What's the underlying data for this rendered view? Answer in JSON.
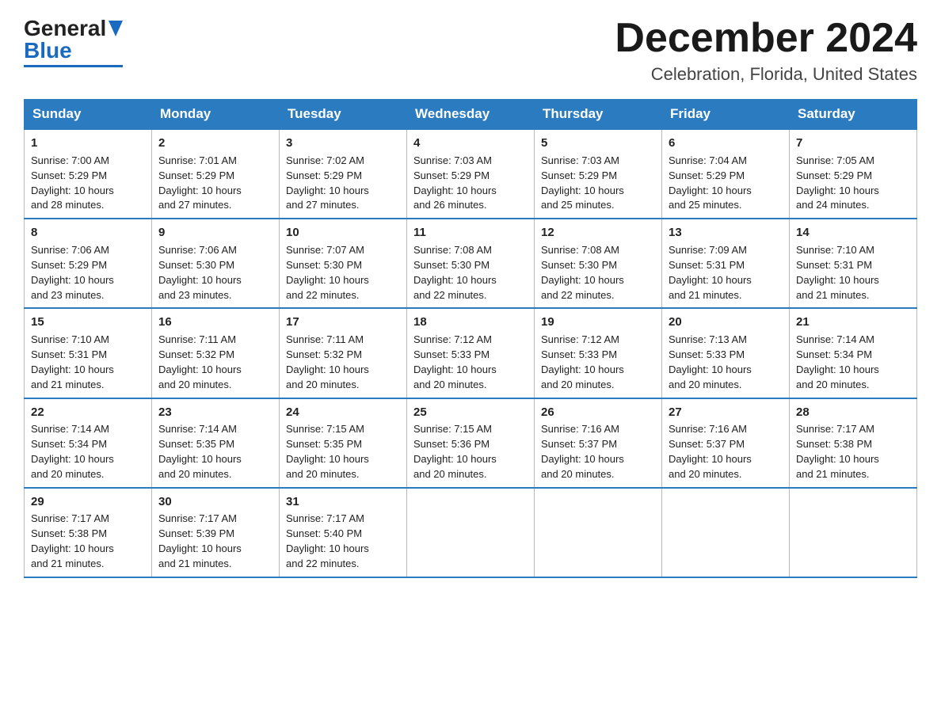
{
  "header": {
    "logo_line1": "General",
    "logo_line2": "Blue",
    "month_title": "December 2024",
    "subtitle": "Celebration, Florida, United States"
  },
  "weekdays": [
    "Sunday",
    "Monday",
    "Tuesday",
    "Wednesday",
    "Thursday",
    "Friday",
    "Saturday"
  ],
  "weeks": [
    [
      {
        "day": "1",
        "sunrise": "Sunrise: 7:00 AM",
        "sunset": "Sunset: 5:29 PM",
        "daylight": "Daylight: 10 hours",
        "daylight2": "and 28 minutes."
      },
      {
        "day": "2",
        "sunrise": "Sunrise: 7:01 AM",
        "sunset": "Sunset: 5:29 PM",
        "daylight": "Daylight: 10 hours",
        "daylight2": "and 27 minutes."
      },
      {
        "day": "3",
        "sunrise": "Sunrise: 7:02 AM",
        "sunset": "Sunset: 5:29 PM",
        "daylight": "Daylight: 10 hours",
        "daylight2": "and 27 minutes."
      },
      {
        "day": "4",
        "sunrise": "Sunrise: 7:03 AM",
        "sunset": "Sunset: 5:29 PM",
        "daylight": "Daylight: 10 hours",
        "daylight2": "and 26 minutes."
      },
      {
        "day": "5",
        "sunrise": "Sunrise: 7:03 AM",
        "sunset": "Sunset: 5:29 PM",
        "daylight": "Daylight: 10 hours",
        "daylight2": "and 25 minutes."
      },
      {
        "day": "6",
        "sunrise": "Sunrise: 7:04 AM",
        "sunset": "Sunset: 5:29 PM",
        "daylight": "Daylight: 10 hours",
        "daylight2": "and 25 minutes."
      },
      {
        "day": "7",
        "sunrise": "Sunrise: 7:05 AM",
        "sunset": "Sunset: 5:29 PM",
        "daylight": "Daylight: 10 hours",
        "daylight2": "and 24 minutes."
      }
    ],
    [
      {
        "day": "8",
        "sunrise": "Sunrise: 7:06 AM",
        "sunset": "Sunset: 5:29 PM",
        "daylight": "Daylight: 10 hours",
        "daylight2": "and 23 minutes."
      },
      {
        "day": "9",
        "sunrise": "Sunrise: 7:06 AM",
        "sunset": "Sunset: 5:30 PM",
        "daylight": "Daylight: 10 hours",
        "daylight2": "and 23 minutes."
      },
      {
        "day": "10",
        "sunrise": "Sunrise: 7:07 AM",
        "sunset": "Sunset: 5:30 PM",
        "daylight": "Daylight: 10 hours",
        "daylight2": "and 22 minutes."
      },
      {
        "day": "11",
        "sunrise": "Sunrise: 7:08 AM",
        "sunset": "Sunset: 5:30 PM",
        "daylight": "Daylight: 10 hours",
        "daylight2": "and 22 minutes."
      },
      {
        "day": "12",
        "sunrise": "Sunrise: 7:08 AM",
        "sunset": "Sunset: 5:30 PM",
        "daylight": "Daylight: 10 hours",
        "daylight2": "and 22 minutes."
      },
      {
        "day": "13",
        "sunrise": "Sunrise: 7:09 AM",
        "sunset": "Sunset: 5:31 PM",
        "daylight": "Daylight: 10 hours",
        "daylight2": "and 21 minutes."
      },
      {
        "day": "14",
        "sunrise": "Sunrise: 7:10 AM",
        "sunset": "Sunset: 5:31 PM",
        "daylight": "Daylight: 10 hours",
        "daylight2": "and 21 minutes."
      }
    ],
    [
      {
        "day": "15",
        "sunrise": "Sunrise: 7:10 AM",
        "sunset": "Sunset: 5:31 PM",
        "daylight": "Daylight: 10 hours",
        "daylight2": "and 21 minutes."
      },
      {
        "day": "16",
        "sunrise": "Sunrise: 7:11 AM",
        "sunset": "Sunset: 5:32 PM",
        "daylight": "Daylight: 10 hours",
        "daylight2": "and 20 minutes."
      },
      {
        "day": "17",
        "sunrise": "Sunrise: 7:11 AM",
        "sunset": "Sunset: 5:32 PM",
        "daylight": "Daylight: 10 hours",
        "daylight2": "and 20 minutes."
      },
      {
        "day": "18",
        "sunrise": "Sunrise: 7:12 AM",
        "sunset": "Sunset: 5:33 PM",
        "daylight": "Daylight: 10 hours",
        "daylight2": "and 20 minutes."
      },
      {
        "day": "19",
        "sunrise": "Sunrise: 7:12 AM",
        "sunset": "Sunset: 5:33 PM",
        "daylight": "Daylight: 10 hours",
        "daylight2": "and 20 minutes."
      },
      {
        "day": "20",
        "sunrise": "Sunrise: 7:13 AM",
        "sunset": "Sunset: 5:33 PM",
        "daylight": "Daylight: 10 hours",
        "daylight2": "and 20 minutes."
      },
      {
        "day": "21",
        "sunrise": "Sunrise: 7:14 AM",
        "sunset": "Sunset: 5:34 PM",
        "daylight": "Daylight: 10 hours",
        "daylight2": "and 20 minutes."
      }
    ],
    [
      {
        "day": "22",
        "sunrise": "Sunrise: 7:14 AM",
        "sunset": "Sunset: 5:34 PM",
        "daylight": "Daylight: 10 hours",
        "daylight2": "and 20 minutes."
      },
      {
        "day": "23",
        "sunrise": "Sunrise: 7:14 AM",
        "sunset": "Sunset: 5:35 PM",
        "daylight": "Daylight: 10 hours",
        "daylight2": "and 20 minutes."
      },
      {
        "day": "24",
        "sunrise": "Sunrise: 7:15 AM",
        "sunset": "Sunset: 5:35 PM",
        "daylight": "Daylight: 10 hours",
        "daylight2": "and 20 minutes."
      },
      {
        "day": "25",
        "sunrise": "Sunrise: 7:15 AM",
        "sunset": "Sunset: 5:36 PM",
        "daylight": "Daylight: 10 hours",
        "daylight2": "and 20 minutes."
      },
      {
        "day": "26",
        "sunrise": "Sunrise: 7:16 AM",
        "sunset": "Sunset: 5:37 PM",
        "daylight": "Daylight: 10 hours",
        "daylight2": "and 20 minutes."
      },
      {
        "day": "27",
        "sunrise": "Sunrise: 7:16 AM",
        "sunset": "Sunset: 5:37 PM",
        "daylight": "Daylight: 10 hours",
        "daylight2": "and 20 minutes."
      },
      {
        "day": "28",
        "sunrise": "Sunrise: 7:17 AM",
        "sunset": "Sunset: 5:38 PM",
        "daylight": "Daylight: 10 hours",
        "daylight2": "and 21 minutes."
      }
    ],
    [
      {
        "day": "29",
        "sunrise": "Sunrise: 7:17 AM",
        "sunset": "Sunset: 5:38 PM",
        "daylight": "Daylight: 10 hours",
        "daylight2": "and 21 minutes."
      },
      {
        "day": "30",
        "sunrise": "Sunrise: 7:17 AM",
        "sunset": "Sunset: 5:39 PM",
        "daylight": "Daylight: 10 hours",
        "daylight2": "and 21 minutes."
      },
      {
        "day": "31",
        "sunrise": "Sunrise: 7:17 AM",
        "sunset": "Sunset: 5:40 PM",
        "daylight": "Daylight: 10 hours",
        "daylight2": "and 22 minutes."
      },
      null,
      null,
      null,
      null
    ]
  ]
}
